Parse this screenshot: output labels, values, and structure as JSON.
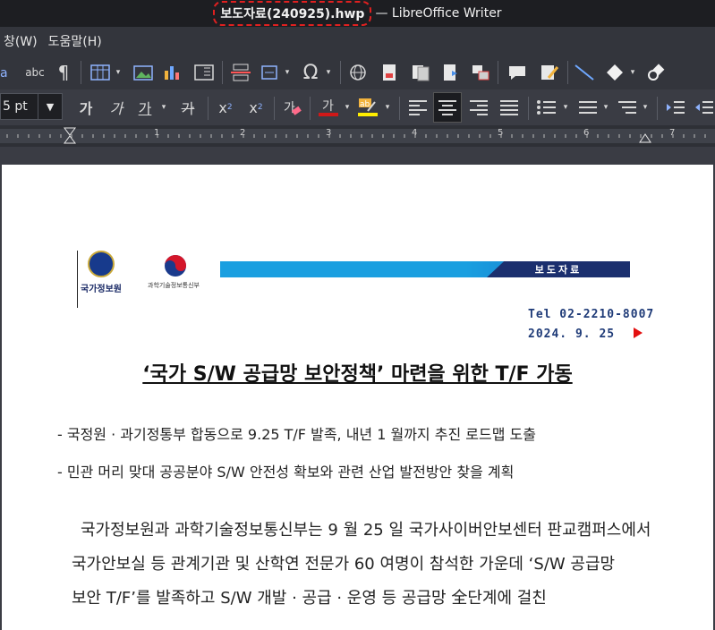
{
  "window": {
    "doc_title": "보도자료(240925).hwp",
    "app_title": "— LibreOffice Writer"
  },
  "menu": {
    "items": [
      "창(W)",
      "도움말(H)"
    ]
  },
  "toolbar": {
    "font_size": "5 pt",
    "glyphs": {
      "spell": "abc",
      "pilcrow": "¶",
      "bold": "가",
      "italic": "가",
      "underline": "가",
      "strike": "가",
      "superscript": "x",
      "subscript": "x",
      "omega": "Ω"
    }
  },
  "ruler": {
    "numbers": [
      "1",
      "2",
      "3",
      "4",
      "5",
      "6",
      "7"
    ]
  },
  "document": {
    "nis_label": "국가정보원",
    "msit_label": "과학기술정보통신부",
    "banner_label": "보도자료",
    "tel": "Tel 02-2210-8007",
    "date": "2024. 9. 25",
    "headline": "‘국가 S/W 공급망 보안정책’  마련을 위한 T/F 가동",
    "bullets": [
      "-  국정원 · 과기정통부 합동으로 9.25 T/F 발족, 내년 1 월까지 추진 로드맵 도출",
      "-  민관 머리 맞대 공공분야 S/W 안전성 확보와 관련 산업 발전방안 찾을 계획"
    ],
    "paragraph_lines": [
      "국가정보원과 과학기술정보통신부는 9 월 25 일 국가사이버안보센터 판교캠퍼스에서",
      "국가안보실 등 관계기관 및 산학연 전문가 60 여명이 참석한 가운데  ‘S/W 공급망",
      "보안 T/F’를 발족하고  S/W 개발 · 공급 · 운영 등 공급망 全단계에 걸친"
    ]
  },
  "colors": {
    "accent_red": "#e02020",
    "banner_blue": "#1a9fe0",
    "navy": "#1f3b78"
  }
}
